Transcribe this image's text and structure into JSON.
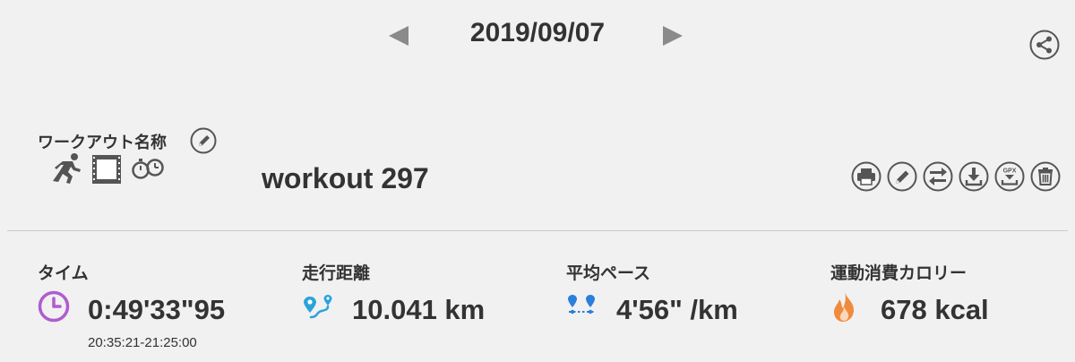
{
  "date_nav": {
    "date": "2019/09/07"
  },
  "workout": {
    "title_label": "ワークアウト名称",
    "name": "workout 297",
    "type_icons": [
      "running-icon",
      "film-frame-icon",
      "stopwatch-icon"
    ]
  },
  "actions": [
    "print-icon",
    "pencil-icon",
    "swap-icon",
    "download-icon",
    "gpx-export-icon",
    "trash-icon"
  ],
  "stats": {
    "time": {
      "label": "タイム",
      "value": "0:49'33\"95",
      "range": "20:35:21-21:25:00",
      "icon": "clock-icon",
      "color": "#b05cd0"
    },
    "distance": {
      "label": "走行距離",
      "value": "10.041 km",
      "icon": "route-pin-icon",
      "color": "#2aa3dc"
    },
    "pace": {
      "label": "平均ペース",
      "value": "4'56\" /km",
      "icon": "pace-pins-icon",
      "color": "#2a7fdc"
    },
    "calories": {
      "label": "運動消費カロリー",
      "value": "678 kcal",
      "icon": "flame-icon",
      "color": "#f08a3c"
    }
  }
}
